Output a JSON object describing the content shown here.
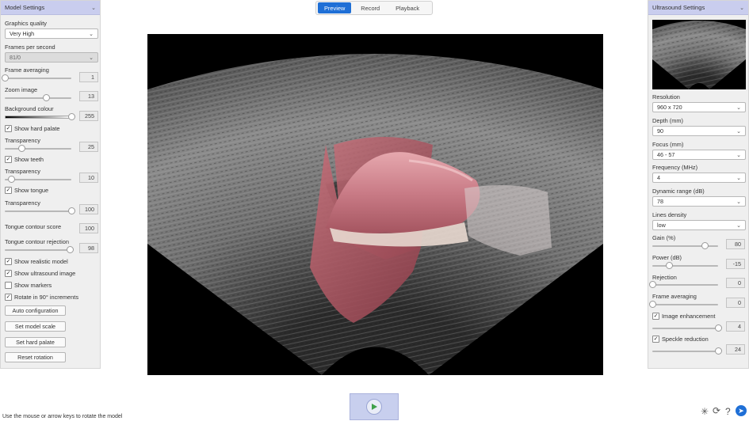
{
  "tabs": [
    {
      "label": "Preview",
      "active": true
    },
    {
      "label": "Record",
      "active": false
    },
    {
      "label": "Playback",
      "active": false
    }
  ],
  "left_panel": {
    "title": "Model Settings",
    "graphics_quality": {
      "label": "Graphics quality",
      "value": "Very High"
    },
    "fps": {
      "label": "Frames per second",
      "value": "81/0"
    },
    "frame_averaging": {
      "label": "Frame averaging",
      "value": "1",
      "level": 0.0
    },
    "zoom_image": {
      "label": "Zoom image",
      "value": "13",
      "level": 0.62
    },
    "background_colour": {
      "label": "Background colour",
      "value": "255",
      "level": 1.0
    },
    "show_hard_palate": {
      "label": "Show hard palate",
      "checked": true
    },
    "transparency_1": {
      "label": "Transparency",
      "value": "25",
      "level": 0.25
    },
    "show_teeth": {
      "label": "Show teeth",
      "checked": true
    },
    "transparency_2": {
      "label": "Transparency",
      "value": "10",
      "level": 0.1
    },
    "show_tongue": {
      "label": "Show tongue",
      "checked": true
    },
    "transparency_3": {
      "label": "Transparency",
      "value": "100",
      "level": 1.0
    },
    "tongue_contour_score": {
      "label": "Tongue contour score",
      "value": "100"
    },
    "tongue_contour_rejection": {
      "label": "Tongue contour rejection",
      "value": "98",
      "level": 0.98
    },
    "show_realistic_model": {
      "label": "Show realistic model",
      "checked": true
    },
    "show_ultrasound_image": {
      "label": "Show ultrasound image",
      "checked": true
    },
    "show_markers": {
      "label": "Show markers",
      "checked": false
    },
    "rotate_90": {
      "label": "Rotate in 90° increments",
      "checked": true
    },
    "buttons": [
      "Auto configuration",
      "Set model scale",
      "Set hard palate",
      "Reset rotation"
    ]
  },
  "right_panel": {
    "title": "Ultrasound Settings",
    "resolution": {
      "label": "Resolution",
      "value": "960 x 720"
    },
    "depth": {
      "label": "Depth (mm)",
      "value": "90"
    },
    "focus": {
      "label": "Focus (mm)",
      "value": "46 - 57"
    },
    "frequency": {
      "label": "Frequency (MHz)",
      "value": "4"
    },
    "dynamic_range": {
      "label": "Dynamic range (dB)",
      "value": "78"
    },
    "lines_density": {
      "label": "Lines density",
      "value": "low"
    },
    "gain": {
      "label": "Gain (%)",
      "value": "80",
      "level": 0.8
    },
    "power": {
      "label": "Power (dB)",
      "value": "-15",
      "level": 0.25
    },
    "rejection": {
      "label": "Rejection",
      "value": "0",
      "level": 0.0
    },
    "frame_averaging": {
      "label": "Frame averaging",
      "value": "0",
      "level": 0.0
    },
    "image_enhancement": {
      "label": "Image enhancement",
      "checked": true,
      "value": "4",
      "level": 1.0
    },
    "speckle_reduction": {
      "label": "Speckle reduction",
      "checked": true,
      "value": "24",
      "level": 1.0
    }
  },
  "status_text": "Use the mouse or arrow keys to rotate the model",
  "corner_icons": [
    "settings-icon",
    "refresh-icon",
    "help-icon",
    "pin-icon"
  ]
}
